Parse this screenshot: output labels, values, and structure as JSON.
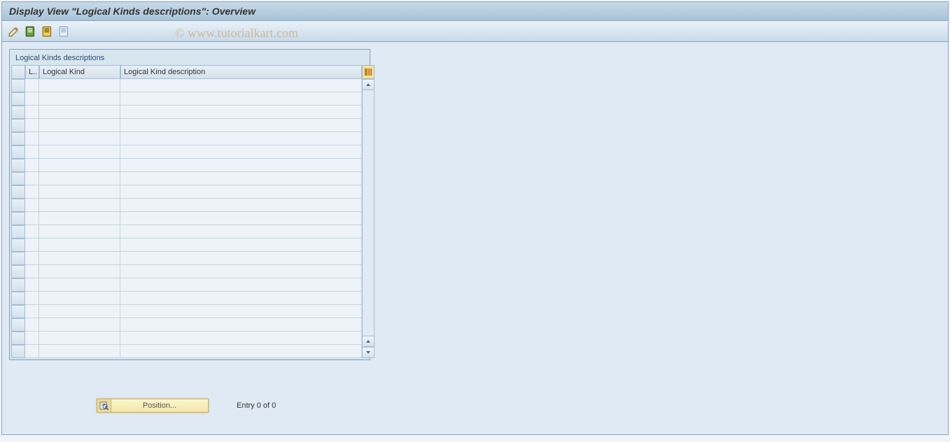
{
  "window": {
    "title": "Display View \"Logical Kinds descriptions\": Overview"
  },
  "toolbar": {
    "icons": [
      "change-icon",
      "select-all-icon",
      "select-block-icon",
      "deselect-all-icon"
    ]
  },
  "table": {
    "title": "Logical Kinds descriptions",
    "columns": {
      "lang": "L..",
      "kind": "Logical Kind",
      "desc": "Logical Kind description"
    },
    "row_count": 21
  },
  "footer": {
    "position_button": "Position...",
    "entry_text": "Entry 0 of 0"
  },
  "watermark": "© www.tutorialkart.com"
}
